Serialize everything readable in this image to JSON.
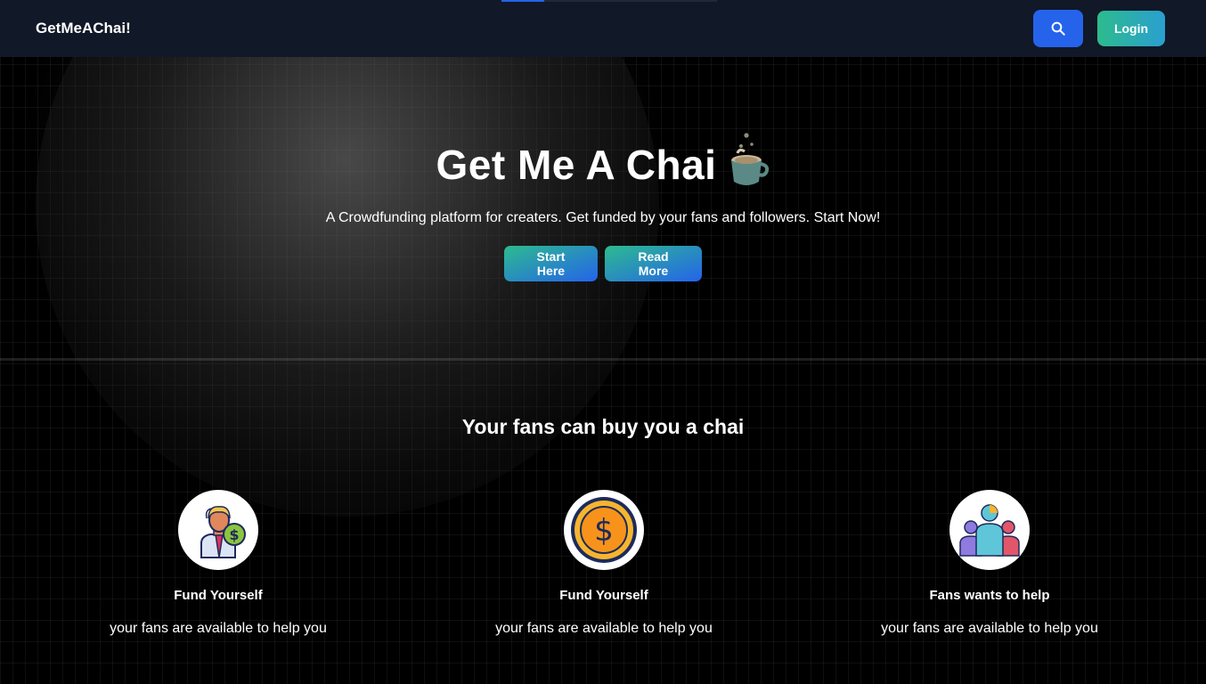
{
  "navbar": {
    "brand": "GetMeAChai!",
    "login_label": "Login",
    "search_icon": "search-icon"
  },
  "hero": {
    "title": "Get Me A Chai",
    "subtitle": "A Crowdfunding platform for creaters. Get funded by your fans and followers. Start Now!",
    "start_label": "Start Here",
    "read_more_label": "Read More",
    "icon": "chai-cup-icon"
  },
  "section": {
    "title": "Your fans can buy you a chai"
  },
  "features": [
    {
      "icon": "businessman-dollar-icon",
      "title": "Fund Yourself",
      "text": "your fans are available to help you"
    },
    {
      "icon": "dollar-coin-icon",
      "title": "Fund Yourself",
      "text": "your fans are available to help you"
    },
    {
      "icon": "people-group-icon",
      "title": "Fans wants to help",
      "text": "your fans are available to help you"
    }
  ],
  "colors": {
    "nav_bg": "#111827",
    "accent_blue": "#2563eb",
    "gradient_green": "#2dbb8e"
  }
}
